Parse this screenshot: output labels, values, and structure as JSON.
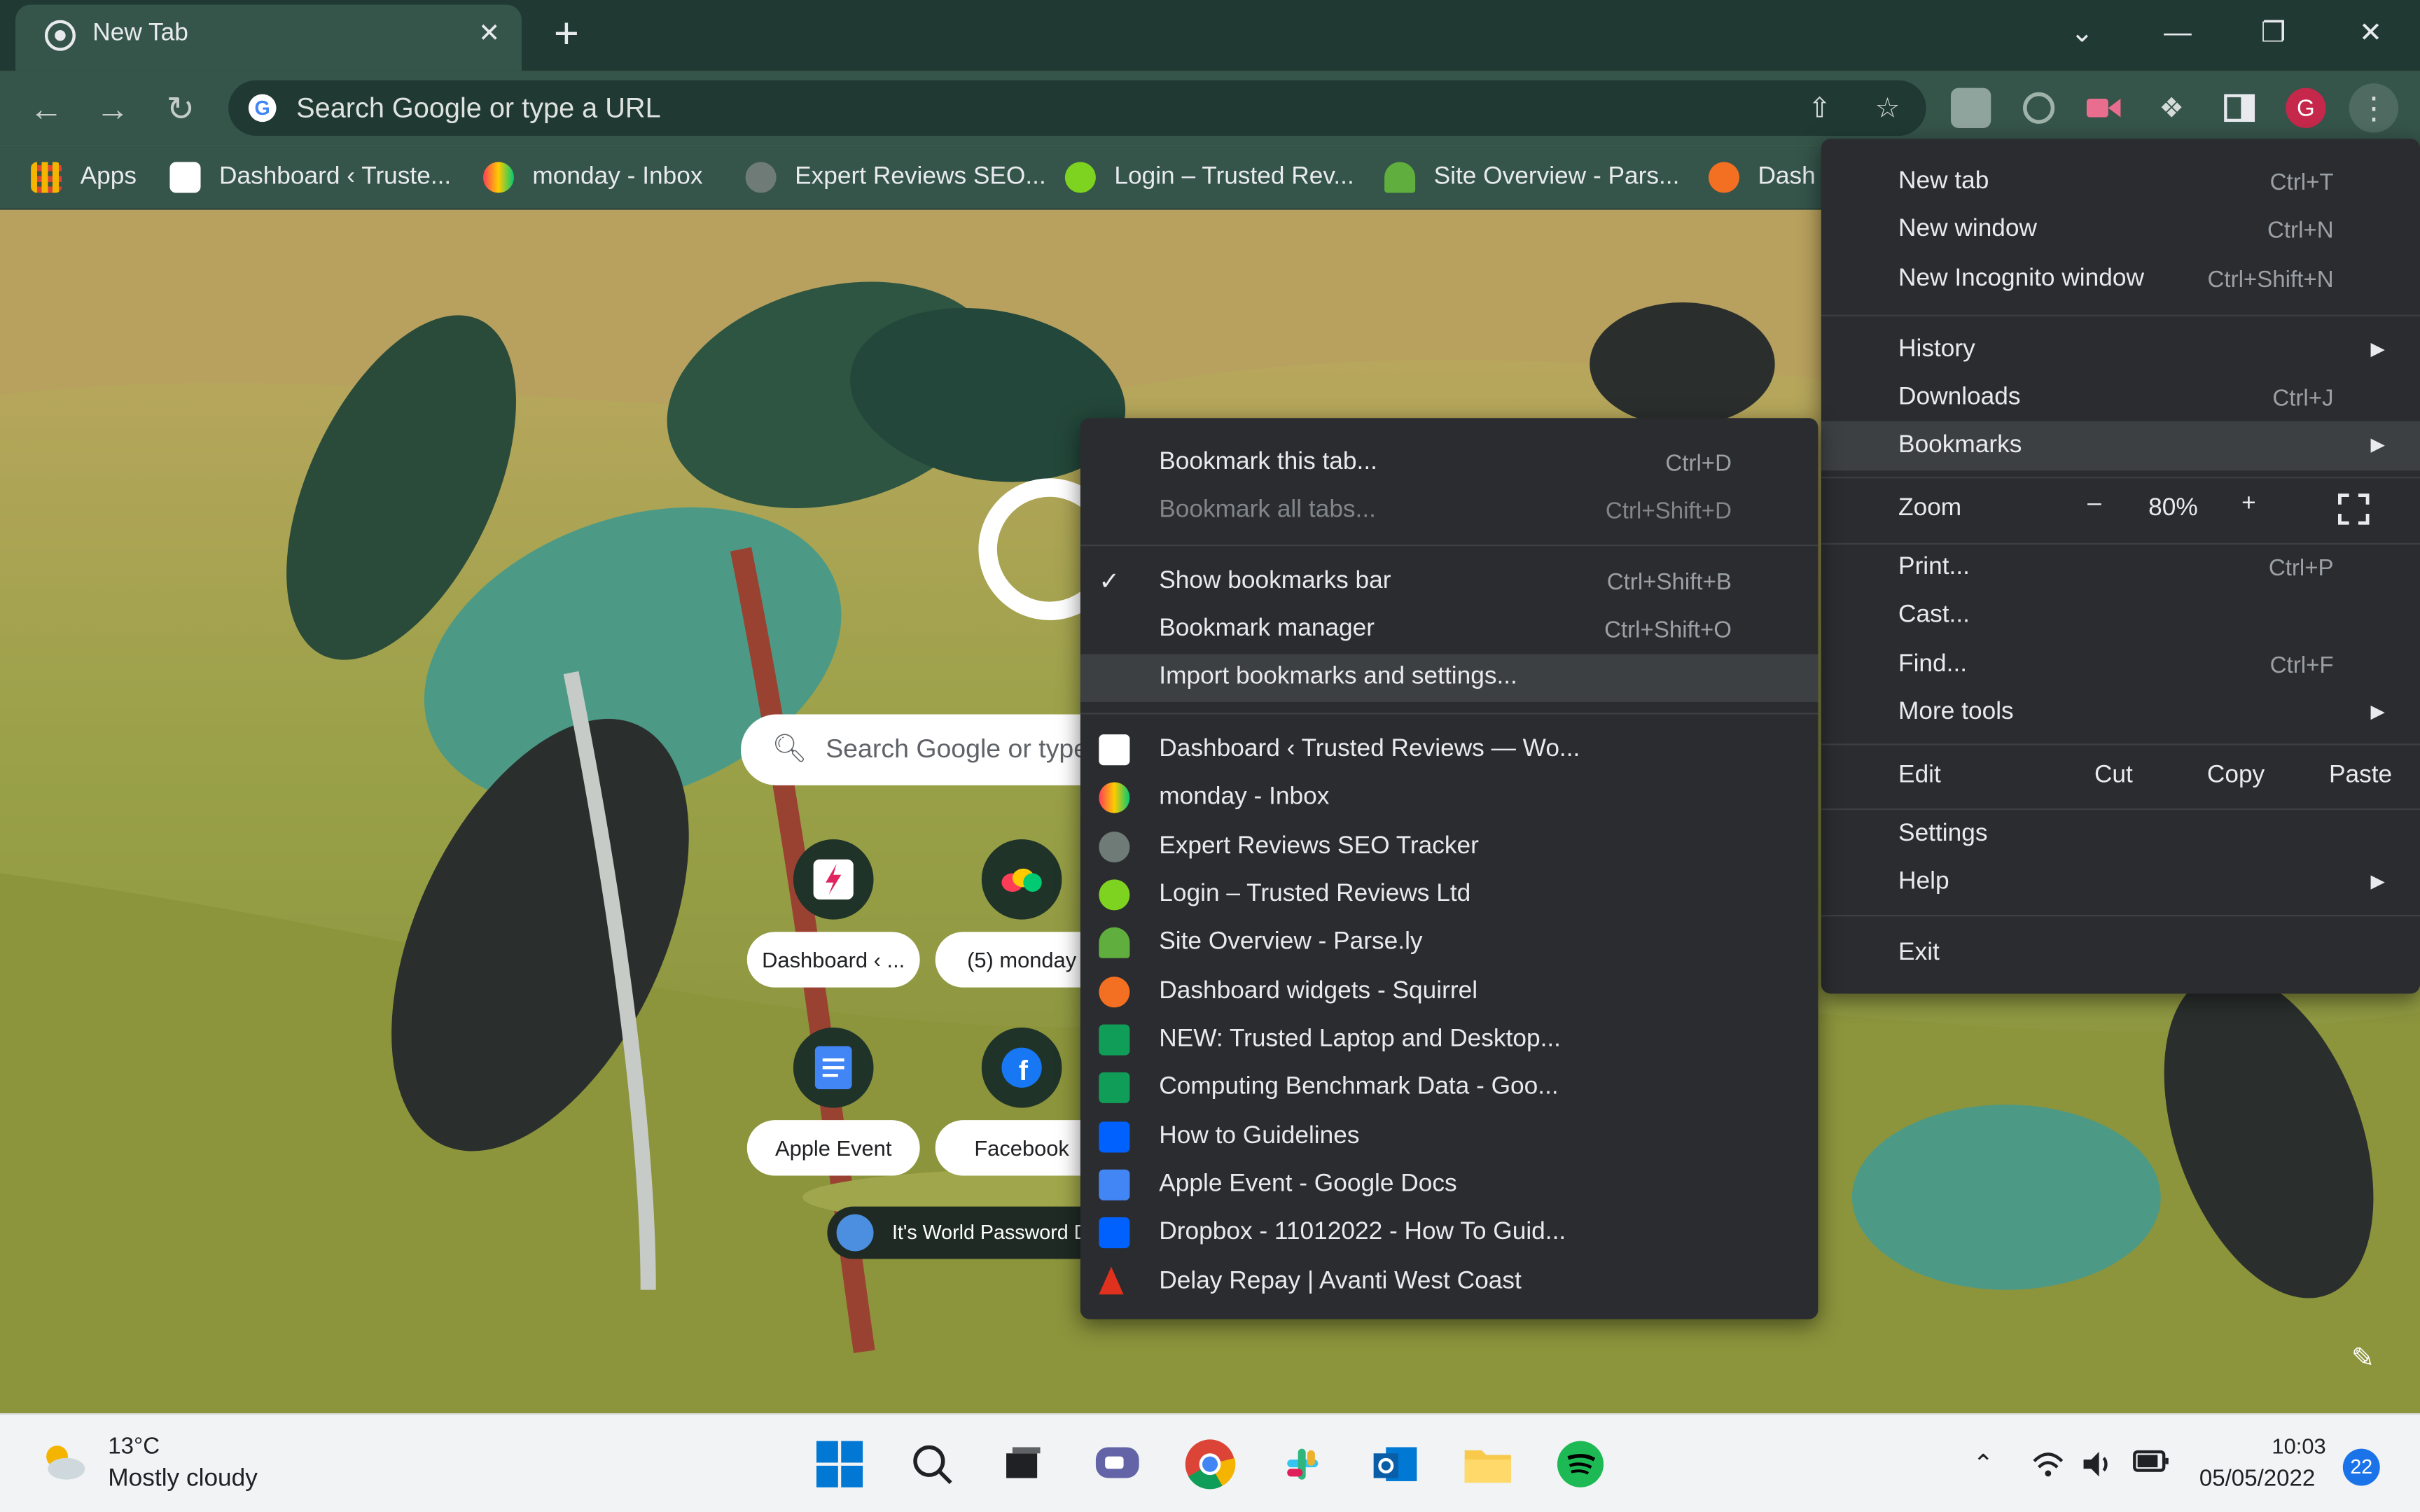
{
  "browser": {
    "tab": {
      "title": "New Tab",
      "close": "✕"
    },
    "new_tab_symbol": "+",
    "window_controls": {
      "tab_search": "⌄",
      "minimize": "—",
      "restore": "❐",
      "close": "✕"
    },
    "omnibox": {
      "placeholder": "Search Google or type a URL"
    },
    "profile_initial": "G",
    "bookmarks_bar": [
      {
        "label": "Apps",
        "icon": "apps-grid-icon",
        "color": "#f4b400"
      },
      {
        "label": "Dashboard ‹ Truste...",
        "icon": "bolt-icon",
        "color": "#ffffff"
      },
      {
        "label": "monday - Inbox",
        "icon": "monday-icon",
        "color": "#ff3d57"
      },
      {
        "label": "Expert Reviews SEO...",
        "icon": "globe-icon",
        "color": "#9aa0a6"
      },
      {
        "label": "Login – Trusted Rev...",
        "icon": "basecamp-icon",
        "color": "#7ed321"
      },
      {
        "label": "Site Overview - Pars...",
        "icon": "parsely-icon",
        "color": "#5fae3e"
      },
      {
        "label": "Dash",
        "icon": "squirrel-icon",
        "color": "#f36f21"
      }
    ]
  },
  "ntp": {
    "search_placeholder": "Search Google or type a URL",
    "shortcuts": [
      {
        "label": "Dashboard ‹ ...",
        "icon": "bolt-icon"
      },
      {
        "label": "(5) monday",
        "icon": "monday-icon"
      },
      {
        "label": "Apple Event",
        "icon": "docs-icon"
      },
      {
        "label": "Facebook",
        "icon": "facebook-icon"
      }
    ],
    "promo": "It's World Password Day"
  },
  "main_menu": {
    "items": [
      {
        "label": "New tab",
        "shortcut": "Ctrl+T"
      },
      {
        "label": "New window",
        "shortcut": "Ctrl+N"
      },
      {
        "label": "New Incognito window",
        "shortcut": "Ctrl+Shift+N"
      },
      {
        "label": "History",
        "shortcut": ""
      },
      {
        "label": "Downloads",
        "shortcut": "Ctrl+J"
      },
      {
        "label": "Bookmarks",
        "shortcut": ""
      },
      {
        "label": "Print...",
        "shortcut": "Ctrl+P"
      },
      {
        "label": "Cast...",
        "shortcut": ""
      },
      {
        "label": "Find...",
        "shortcut": "Ctrl+F"
      },
      {
        "label": "More tools",
        "shortcut": ""
      },
      {
        "label": "Settings",
        "shortcut": ""
      },
      {
        "label": "Help",
        "shortcut": ""
      },
      {
        "label": "Exit",
        "shortcut": ""
      }
    ],
    "zoom": {
      "label": "Zoom",
      "minus": "–",
      "value": "80%",
      "plus": "+"
    },
    "edit": {
      "label": "Edit",
      "cut": "Cut",
      "copy": "Copy",
      "paste": "Paste"
    }
  },
  "bookmarks_menu": {
    "actions": [
      {
        "label": "Bookmark this tab...",
        "shortcut": "Ctrl+D"
      },
      {
        "label": "Bookmark all tabs...",
        "shortcut": "Ctrl+Shift+D"
      },
      {
        "label": "Show bookmarks bar",
        "shortcut": "Ctrl+Shift+B",
        "check": "✓"
      },
      {
        "label": "Bookmark manager",
        "shortcut": "Ctrl+Shift+O"
      },
      {
        "label": "Import bookmarks and settings...",
        "shortcut": ""
      }
    ],
    "bookmarks": [
      {
        "label": "Dashboard ‹ Trusted Reviews — Wo...",
        "icon": "bolt-icon",
        "color": "#ffffff"
      },
      {
        "label": "monday - Inbox",
        "icon": "monday-icon",
        "color": "#ff3d57"
      },
      {
        "label": "Expert Reviews SEO Tracker",
        "icon": "globe-icon",
        "color": "#9aa0a6"
      },
      {
        "label": "Login – Trusted Reviews Ltd",
        "icon": "basecamp-icon",
        "color": "#7ed321"
      },
      {
        "label": "Site Overview - Parse.ly",
        "icon": "parsely-icon",
        "color": "#5fae3e"
      },
      {
        "label": "Dashboard widgets - Squirrel",
        "icon": "squirrel-icon",
        "color": "#f36f21"
      },
      {
        "label": "NEW: Trusted Laptop and Desktop...",
        "icon": "sheets-icon",
        "color": "#0f9d58"
      },
      {
        "label": "Computing Benchmark Data - Goo...",
        "icon": "sheets-icon",
        "color": "#0f9d58"
      },
      {
        "label": "How to Guidelines",
        "icon": "dropbox-icon",
        "color": "#0061ff"
      },
      {
        "label": "Apple Event - Google Docs",
        "icon": "docs-icon",
        "color": "#4285f4"
      },
      {
        "label": "Dropbox - 11012022 - How To Guid...",
        "icon": "dropbox-icon",
        "color": "#0061ff"
      },
      {
        "label": "Delay Repay | Avanti West Coast",
        "icon": "avanti-icon",
        "color": "#e0301e"
      }
    ]
  },
  "taskbar": {
    "weather": {
      "temp": "13°C",
      "desc": "Mostly cloudy"
    },
    "apps": [
      "windows-start-icon",
      "search-icon",
      "task-view-icon",
      "teams-chat-icon",
      "chrome-icon",
      "slack-icon",
      "outlook-icon",
      "file-explorer-icon",
      "spotify-icon"
    ],
    "clock": {
      "time": "10:03",
      "date": "05/05/2022"
    },
    "notifications": "22"
  }
}
